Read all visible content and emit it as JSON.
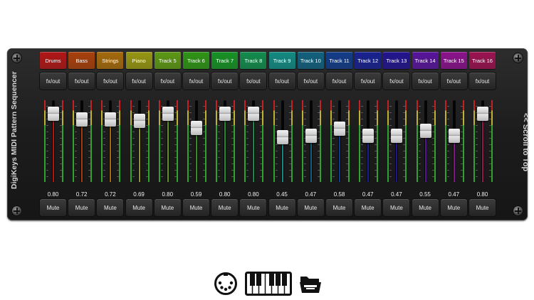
{
  "app": {
    "side_title": "DigiKeys MIDI Pattern Sequencer",
    "scroll_label": "<< Scroll to Top"
  },
  "channels": [
    {
      "name": "Drums",
      "color": "#b01616",
      "fx": "fx/out",
      "value": "0.80",
      "level": 0.8,
      "mute": "Mute"
    },
    {
      "name": "Bass",
      "color": "#a8400c",
      "fx": "fx/out",
      "value": "0.72",
      "level": 0.72,
      "mute": "Mute"
    },
    {
      "name": "Strings",
      "color": "#a46a0c",
      "fx": "fx/out",
      "value": "0.72",
      "level": 0.72,
      "mute": "Mute"
    },
    {
      "name": "Piano",
      "color": "#969612",
      "fx": "fx/out",
      "value": "0.69",
      "level": 0.69,
      "mute": "Mute"
    },
    {
      "name": "Track 5",
      "color": "#5c9814",
      "fx": "fx/out",
      "value": "0.80",
      "level": 0.8,
      "mute": "Mute"
    },
    {
      "name": "Track 6",
      "color": "#2e9416",
      "fx": "fx/out",
      "value": "0.59",
      "level": 0.59,
      "mute": "Mute"
    },
    {
      "name": "Track 7",
      "color": "#169226",
      "fx": "fx/out",
      "value": "0.80",
      "level": 0.8,
      "mute": "Mute"
    },
    {
      "name": "Track 8",
      "color": "#128c4c",
      "fx": "fx/out",
      "value": "0.80",
      "level": 0.8,
      "mute": "Mute"
    },
    {
      "name": "Track 9",
      "color": "#128a82",
      "fx": "fx/out",
      "value": "0.45",
      "level": 0.45,
      "mute": "Mute"
    },
    {
      "name": "Track 10",
      "color": "#12607e",
      "fx": "fx/out",
      "value": "0.47",
      "level": 0.47,
      "mute": "Mute"
    },
    {
      "name": "Track 11",
      "color": "#123c88",
      "fx": "fx/out",
      "value": "0.58",
      "level": 0.58,
      "mute": "Mute"
    },
    {
      "name": "Track 12",
      "color": "#182290",
      "fx": "fx/out",
      "value": "0.47",
      "level": 0.47,
      "mute": "Mute"
    },
    {
      "name": "Track 13",
      "color": "#22148e",
      "fx": "fx/out",
      "value": "0.47",
      "level": 0.47,
      "mute": "Mute"
    },
    {
      "name": "Track 14",
      "color": "#58149a",
      "fx": "fx/out",
      "value": "0.55",
      "level": 0.55,
      "mute": "Mute"
    },
    {
      "name": "Track 15",
      "color": "#8a128c",
      "fx": "fx/out",
      "value": "0.47",
      "level": 0.47,
      "mute": "Mute"
    },
    {
      "name": "Track 16",
      "color": "#9a1250",
      "fx": "fx/out",
      "value": "0.80",
      "level": 0.8,
      "mute": "Mute"
    }
  ],
  "bottom_icons": [
    "midi-connector-icon",
    "piano-keyboard-icon",
    "folder-icon"
  ]
}
